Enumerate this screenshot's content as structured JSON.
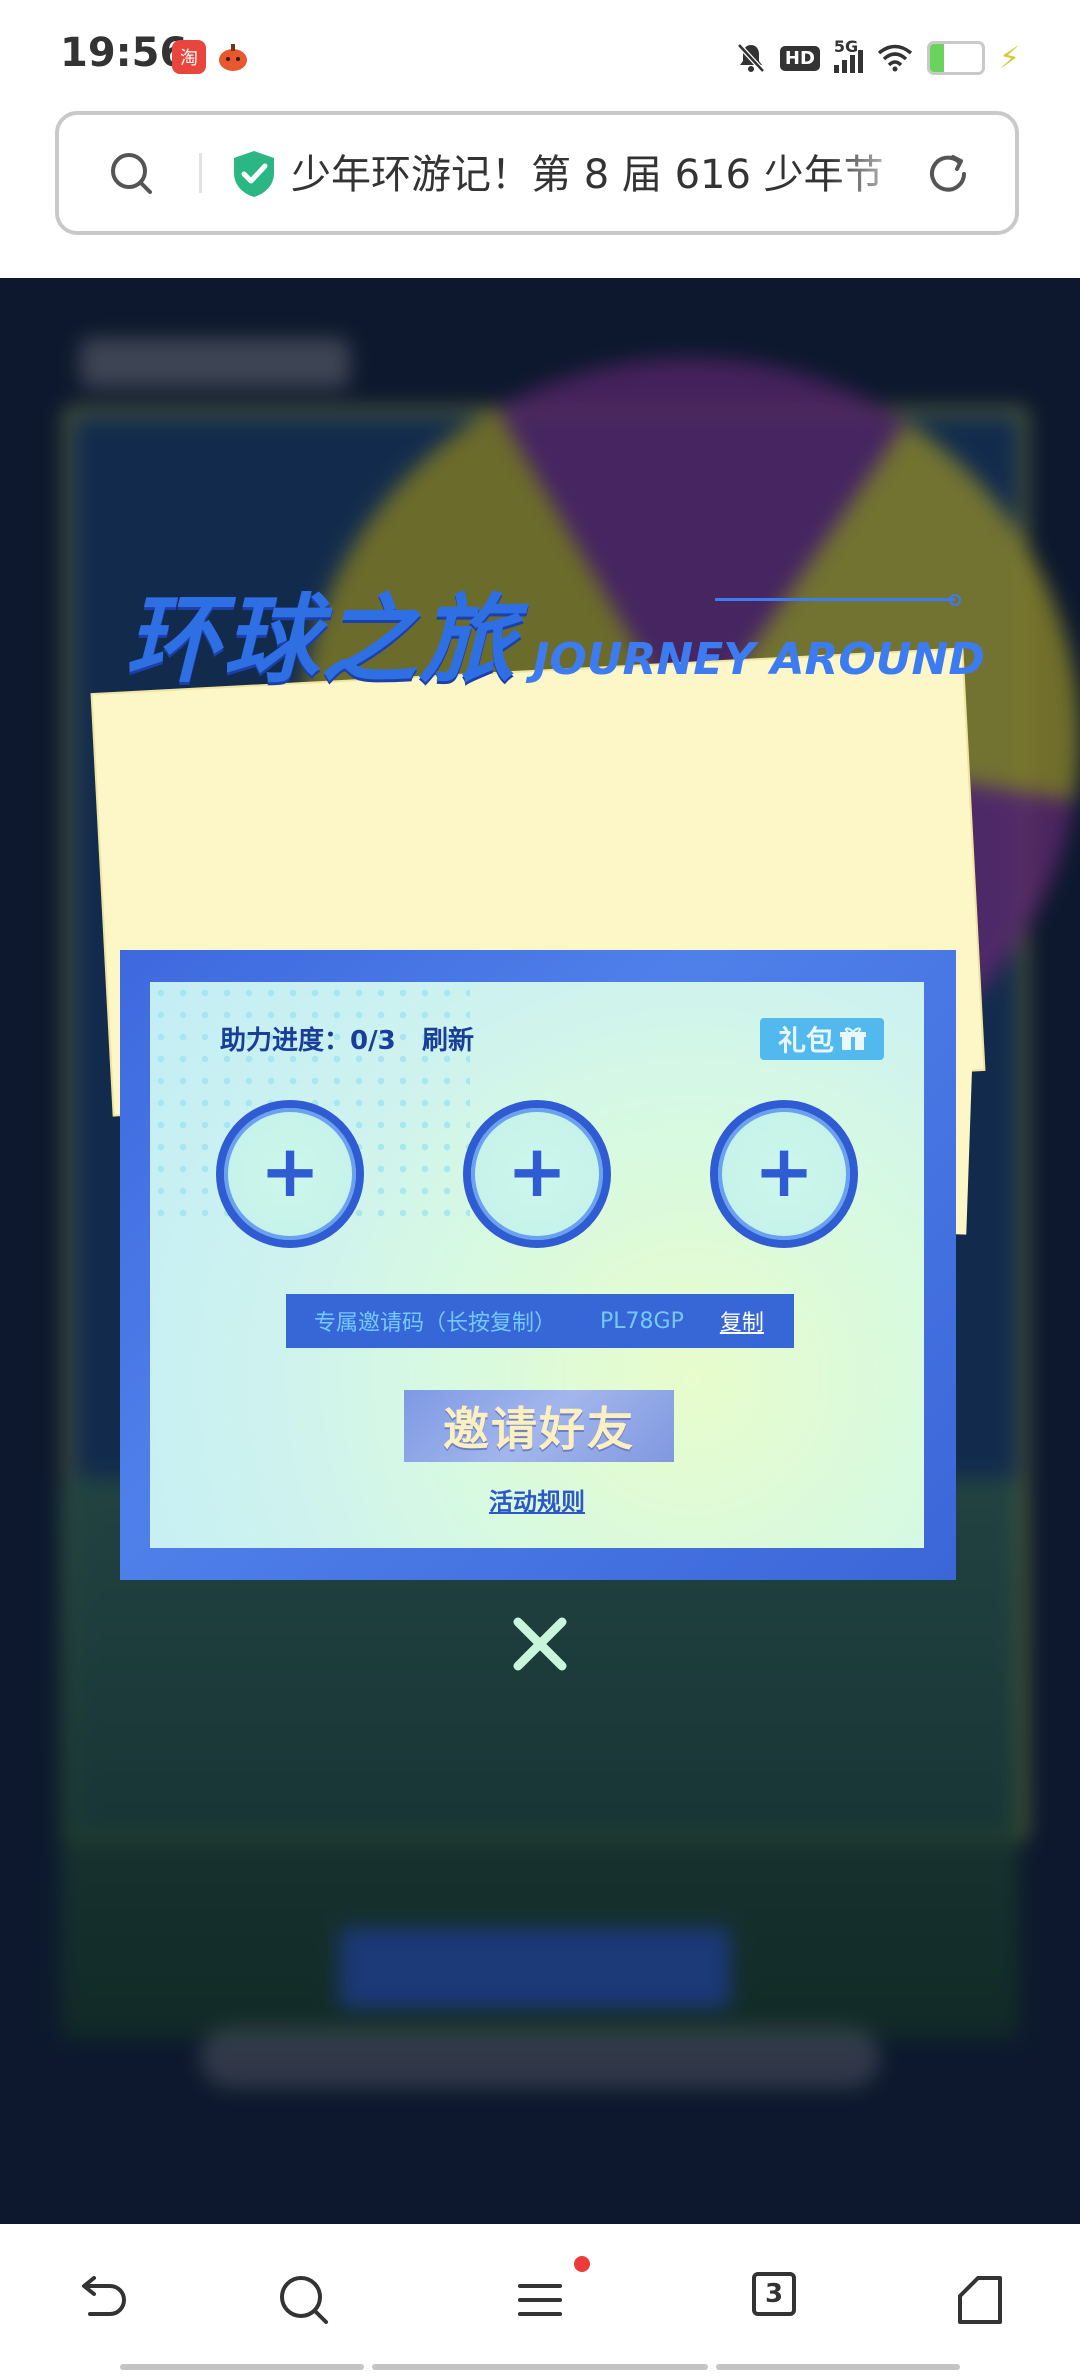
{
  "status_bar": {
    "time": "19:56",
    "notification_icons": [
      "taobao-icon",
      "pumpkin-app-icon"
    ],
    "network": "5G",
    "hd": "HD",
    "battery_percent": "28",
    "battery_level": 0.28
  },
  "address_bar": {
    "url_text": "少年环游记！第 8 届 616 少年节",
    "secure": true
  },
  "modal": {
    "title_cn": "环球之旅",
    "title_en": "JOURNEY AROUND",
    "progress_label": "助力进度：0/3",
    "refresh_label": "刷新",
    "gift_label": "礼包",
    "slots": [
      "+",
      "+",
      "+"
    ],
    "invite_code_label": "专属邀请码（长按复制）",
    "invite_code": "PL78GP",
    "copy_label": "复制",
    "invite_button": "邀请好友",
    "rules_link": "活动规则"
  },
  "bottom_nav": {
    "tab_count": "3",
    "has_menu_badge": true
  },
  "colors": {
    "accent_blue": "#3766d6",
    "title_blue": "#2f6fe4",
    "badge_red": "#ec3b3b"
  }
}
